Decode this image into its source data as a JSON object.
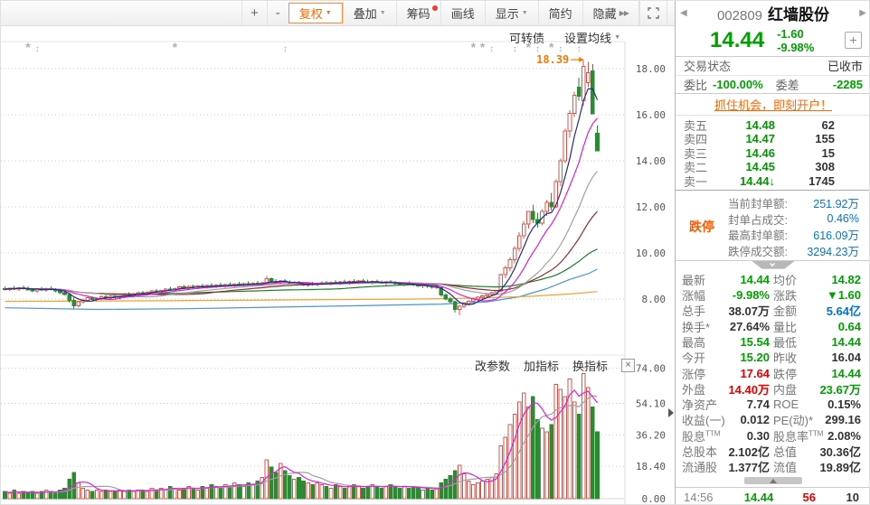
{
  "toolbar": {
    "zoom_in": "+",
    "zoom_out": "-",
    "buttons": [
      {
        "name": "adjust-price",
        "label": "复权",
        "dropdown": true,
        "active": true
      },
      {
        "name": "overlay",
        "label": "叠加",
        "dropdown": true
      },
      {
        "name": "chips",
        "label": "筹码",
        "dot": true
      },
      {
        "name": "draw-line",
        "label": "画线"
      },
      {
        "name": "display",
        "label": "显示",
        "dropdown": true
      },
      {
        "name": "simple-mode",
        "label": "简约"
      },
      {
        "name": "hide",
        "label": "隐藏",
        "chevrons": "▶▶"
      }
    ]
  },
  "chart_links": {
    "convertible_bond": "可转债",
    "ma_settings": "设置均线"
  },
  "indicator_links": {
    "edit_params": "改参数",
    "add_indicator": "加指标",
    "switch_indicator": "换指标",
    "close": "×"
  },
  "chart_data": {
    "type": "candlestick+volume",
    "title": "002809 红墙股份 日K",
    "price_axis": {
      "labels": [
        "18.00",
        "16.00",
        "14.00",
        "12.00",
        "10.00",
        "8.00"
      ],
      "values": [
        18,
        16,
        14,
        12,
        10,
        8
      ]
    },
    "volume_axis": {
      "labels": [
        "74.00",
        "54.10",
        "36.20",
        "18.40",
        "0.00"
      ],
      "values": [
        74,
        54.1,
        36.2,
        18.4,
        0
      ]
    },
    "annotation": {
      "text": "18.39",
      "value": 18.39
    },
    "colors": {
      "up": "#d9544a",
      "down": "#2c8a33",
      "ma5": "#1f2d86",
      "ma10": "#e020d8",
      "ma20": "#a0a0a0",
      "ma30": "#8c3030",
      "ma60": "#1e7d2c",
      "ma_long_blue": "#4a97d2",
      "ma_long_orange": "#f0a32f",
      "vol_ma5": "#e020d8",
      "vol_ma10": "#a0a0a0",
      "annotation": "#ff7700",
      "marker": "#b0b0b0"
    },
    "candles": [
      [
        8.45,
        8.55,
        8.38,
        8.42
      ],
      [
        8.42,
        8.5,
        8.35,
        8.48
      ],
      [
        8.48,
        8.56,
        8.4,
        8.44
      ],
      [
        8.44,
        8.52,
        8.36,
        8.5
      ],
      [
        8.5,
        8.58,
        8.42,
        8.46
      ],
      [
        8.46,
        8.54,
        8.38,
        8.4
      ],
      [
        8.4,
        8.48,
        8.3,
        8.36
      ],
      [
        8.36,
        8.46,
        8.28,
        8.44
      ],
      [
        8.44,
        8.52,
        8.36,
        8.4
      ],
      [
        8.4,
        8.5,
        8.32,
        8.46
      ],
      [
        8.46,
        8.55,
        8.38,
        8.42
      ],
      [
        8.42,
        8.48,
        8.3,
        8.35
      ],
      [
        8.35,
        8.42,
        8.22,
        8.28
      ],
      [
        8.28,
        8.38,
        8.15,
        8.2
      ],
      [
        8.2,
        8.25,
        7.85,
        7.95
      ],
      [
        7.95,
        8.05,
        7.58,
        7.7
      ],
      [
        7.7,
        7.92,
        7.62,
        7.88
      ],
      [
        7.88,
        8.02,
        7.8,
        7.95
      ],
      [
        7.95,
        8.1,
        7.88,
        8.05
      ],
      [
        8.05,
        8.12,
        7.92,
        7.98
      ],
      [
        7.98,
        8.08,
        7.88,
        8.02
      ],
      [
        8.02,
        8.15,
        7.95,
        8.1
      ],
      [
        8.1,
        8.2,
        8.0,
        8.06
      ],
      [
        8.06,
        8.16,
        7.96,
        8.12
      ],
      [
        8.12,
        8.22,
        8.02,
        8.08
      ],
      [
        8.08,
        8.18,
        7.98,
        8.15
      ],
      [
        8.15,
        8.25,
        8.05,
        8.2
      ],
      [
        8.2,
        8.3,
        8.1,
        8.16
      ],
      [
        8.16,
        8.26,
        8.06,
        8.22
      ],
      [
        8.22,
        8.32,
        8.12,
        8.28
      ],
      [
        8.28,
        8.36,
        8.2,
        8.24
      ],
      [
        8.24,
        8.34,
        8.18,
        8.3
      ],
      [
        8.3,
        8.4,
        8.24,
        8.36
      ],
      [
        8.36,
        8.44,
        8.28,
        8.32
      ],
      [
        8.32,
        8.42,
        8.26,
        8.38
      ],
      [
        8.38,
        8.48,
        8.3,
        8.44
      ],
      [
        8.44,
        8.52,
        8.36,
        8.4
      ],
      [
        8.4,
        8.5,
        8.34,
        8.46
      ],
      [
        8.46,
        8.56,
        8.4,
        8.52
      ],
      [
        8.52,
        8.6,
        8.44,
        8.48
      ],
      [
        8.48,
        8.58,
        8.4,
        8.54
      ],
      [
        8.54,
        8.62,
        8.46,
        8.5
      ],
      [
        8.5,
        8.6,
        8.44,
        8.56
      ],
      [
        8.56,
        8.66,
        8.48,
        8.52
      ],
      [
        8.52,
        8.62,
        8.46,
        8.58
      ],
      [
        8.58,
        8.68,
        8.5,
        8.54
      ],
      [
        8.54,
        8.64,
        8.48,
        8.6
      ],
      [
        8.6,
        8.7,
        8.52,
        8.56
      ],
      [
        8.56,
        8.66,
        8.5,
        8.62
      ],
      [
        8.62,
        8.72,
        8.54,
        8.58
      ],
      [
        8.58,
        8.68,
        8.52,
        8.64
      ],
      [
        8.64,
        8.74,
        8.56,
        8.6
      ],
      [
        8.6,
        8.7,
        8.54,
        8.66
      ],
      [
        8.66,
        8.76,
        8.58,
        8.62
      ],
      [
        8.62,
        8.72,
        8.56,
        8.68
      ],
      [
        8.68,
        8.78,
        8.6,
        8.64
      ],
      [
        8.64,
        8.74,
        8.58,
        8.7
      ],
      [
        8.7,
        9.0,
        8.64,
        8.88
      ],
      [
        8.88,
        8.95,
        8.7,
        8.76
      ],
      [
        8.76,
        8.86,
        8.68,
        8.72
      ],
      [
        8.72,
        8.82,
        8.64,
        8.78
      ],
      [
        8.78,
        8.86,
        8.68,
        8.72
      ],
      [
        8.72,
        8.8,
        8.62,
        8.66
      ],
      [
        8.66,
        8.76,
        8.58,
        8.7
      ],
      [
        8.7,
        8.78,
        8.6,
        8.64
      ],
      [
        8.64,
        8.72,
        8.56,
        8.6
      ],
      [
        8.6,
        8.7,
        8.52,
        8.66
      ],
      [
        8.66,
        8.74,
        8.58,
        8.62
      ],
      [
        8.62,
        8.72,
        8.54,
        8.68
      ],
      [
        8.68,
        8.76,
        8.6,
        8.7
      ],
      [
        8.7,
        8.78,
        8.62,
        8.66
      ],
      [
        8.66,
        8.76,
        8.58,
        8.72
      ],
      [
        8.72,
        8.82,
        8.64,
        8.68
      ],
      [
        8.68,
        8.78,
        8.6,
        8.74
      ],
      [
        8.74,
        8.84,
        8.66,
        8.7
      ],
      [
        8.7,
        8.8,
        8.62,
        8.76
      ],
      [
        8.76,
        8.86,
        8.68,
        8.72
      ],
      [
        8.72,
        8.82,
        8.64,
        8.78
      ],
      [
        8.78,
        8.88,
        8.7,
        8.74
      ],
      [
        8.74,
        8.84,
        8.66,
        8.7
      ],
      [
        8.7,
        8.8,
        8.62,
        8.76
      ],
      [
        8.76,
        8.84,
        8.68,
        8.72
      ],
      [
        8.72,
        8.8,
        8.64,
        8.68
      ],
      [
        8.68,
        8.78,
        8.6,
        8.74
      ],
      [
        8.74,
        8.82,
        8.66,
        8.7
      ],
      [
        8.7,
        8.78,
        8.62,
        8.66
      ],
      [
        8.66,
        8.74,
        8.58,
        8.62
      ],
      [
        8.62,
        8.72,
        8.54,
        8.68
      ],
      [
        8.68,
        8.76,
        8.6,
        8.64
      ],
      [
        8.64,
        8.72,
        8.56,
        8.6
      ],
      [
        8.6,
        8.68,
        8.52,
        8.56
      ],
      [
        8.56,
        8.66,
        8.48,
        8.6
      ],
      [
        8.6,
        8.66,
        8.5,
        8.54
      ],
      [
        8.54,
        8.62,
        8.46,
        8.5
      ],
      [
        8.5,
        8.58,
        8.44,
        8.52
      ],
      [
        8.5,
        8.55,
        8.1,
        8.18
      ],
      [
        8.18,
        8.25,
        7.95,
        8.0
      ],
      [
        8.0,
        8.1,
        7.8,
        7.88
      ],
      [
        7.88,
        7.95,
        7.42,
        7.55
      ],
      [
        7.55,
        7.75,
        7.3,
        7.68
      ],
      [
        7.68,
        7.85,
        7.6,
        7.8
      ],
      [
        7.8,
        7.95,
        7.72,
        7.9
      ],
      [
        7.9,
        8.05,
        7.85,
        8.0
      ],
      [
        8.0,
        8.12,
        7.92,
        8.08
      ],
      [
        8.08,
        8.18,
        8.0,
        8.14
      ],
      [
        8.14,
        8.25,
        8.05,
        8.2
      ],
      [
        8.2,
        8.32,
        8.12,
        8.28
      ],
      [
        8.28,
        8.4,
        8.2,
        8.35
      ],
      [
        8.35,
        9.1,
        8.3,
        9.05
      ],
      [
        9.05,
        9.45,
        8.9,
        9.35
      ],
      [
        9.35,
        9.8,
        9.2,
        9.7
      ],
      [
        9.7,
        10.3,
        9.55,
        10.2
      ],
      [
        10.2,
        10.9,
        10.05,
        10.75
      ],
      [
        10.75,
        11.4,
        10.6,
        11.25
      ],
      [
        11.25,
        11.83,
        11.05,
        11.8
      ],
      [
        11.8,
        12.1,
        11.3,
        11.45
      ],
      [
        11.45,
        11.75,
        11.1,
        11.3
      ],
      [
        11.3,
        11.9,
        11.2,
        11.8
      ],
      [
        11.8,
        12.3,
        11.6,
        12.2
      ],
      [
        12.2,
        12.6,
        11.85,
        12.0
      ],
      [
        12.0,
        13.2,
        11.95,
        13.1
      ],
      [
        13.1,
        14.1,
        12.9,
        14.0
      ],
      [
        14.0,
        15.4,
        13.9,
        15.3
      ],
      [
        15.3,
        16.2,
        15.0,
        16.05
      ],
      [
        16.05,
        17.0,
        15.9,
        16.85
      ],
      [
        17.2,
        17.6,
        16.6,
        16.8
      ],
      [
        16.6,
        18.39,
        16.4,
        18.1
      ],
      [
        17.4,
        18.3,
        17.2,
        17.82
      ],
      [
        17.9,
        18.2,
        16.04,
        16.04
      ],
      [
        15.2,
        15.54,
        14.44,
        14.44
      ]
    ],
    "volumes": [
      4,
      3,
      5,
      3,
      4,
      3,
      4,
      3,
      4,
      5,
      4,
      3,
      5,
      6,
      11,
      15,
      9,
      6,
      5,
      4,
      5,
      4,
      5,
      4,
      4,
      5,
      4,
      5,
      4,
      5,
      5,
      4,
      6,
      5,
      6,
      5,
      7,
      6,
      5,
      6,
      7,
      6,
      5,
      7,
      6,
      8,
      7,
      6,
      8,
      7,
      9,
      8,
      7,
      9,
      8,
      10,
      12,
      22,
      18,
      15,
      20,
      16,
      13,
      11,
      12,
      10,
      9,
      8,
      9,
      8,
      7,
      6,
      8,
      7,
      6,
      7,
      8,
      7,
      6,
      7,
      8,
      7,
      6,
      7,
      8,
      7,
      6,
      7,
      6,
      7,
      6,
      5,
      6,
      5,
      6,
      9,
      11,
      13,
      16,
      19,
      14,
      10,
      8,
      9,
      10,
      11,
      12,
      14,
      30,
      35,
      42,
      48,
      55,
      60,
      52,
      58,
      45,
      40,
      38,
      42,
      65,
      62,
      58,
      68,
      55,
      48,
      71,
      63,
      52,
      38
    ],
    "long_ma_blue": [
      [
        0,
        7.62
      ],
      [
        20,
        7.55
      ],
      [
        40,
        7.58
      ],
      [
        60,
        7.65
      ],
      [
        80,
        7.72
      ],
      [
        95,
        7.78
      ],
      [
        105,
        7.88
      ],
      [
        112,
        8.1
      ],
      [
        118,
        8.45
      ],
      [
        123,
        8.85
      ],
      [
        127,
        9.1
      ],
      [
        129,
        9.3
      ]
    ],
    "long_ma_orange": [
      [
        0,
        7.9
      ],
      [
        30,
        7.92
      ],
      [
        60,
        7.96
      ],
      [
        90,
        8.0
      ],
      [
        105,
        8.05
      ],
      [
        115,
        8.12
      ],
      [
        123,
        8.22
      ],
      [
        129,
        8.32
      ]
    ],
    "event_markers": [
      [
        5,
        "star"
      ],
      [
        7,
        "updown"
      ],
      [
        37,
        "star"
      ],
      [
        61,
        "updown"
      ],
      [
        102,
        "star"
      ],
      [
        104,
        "star"
      ],
      [
        106,
        "updown"
      ],
      [
        111,
        "updown"
      ],
      [
        114,
        "star"
      ],
      [
        116,
        "updown"
      ],
      [
        119,
        "star"
      ],
      [
        121,
        "updown"
      ],
      [
        125,
        "updown"
      ]
    ]
  },
  "panel": {
    "prev_arrow": "◀",
    "next_arrow": "▶",
    "code": "002809",
    "name": "红墙股份",
    "price": "14.44",
    "change": "-1.60",
    "change_pct": "-9.98%",
    "add_button": "+",
    "trade_status_label": "交易状态",
    "trade_status": "已收市",
    "weibi_label": "委比",
    "weibi": "-100.00%",
    "weicha_label": "委差",
    "weicha": "-2285",
    "ad_link": "抓住机会，即刻开户！",
    "sell_orders": [
      {
        "label": "卖五",
        "price": "14.48",
        "vol": "62"
      },
      {
        "label": "卖四",
        "price": "14.47",
        "vol": "155"
      },
      {
        "label": "卖三",
        "price": "14.46",
        "vol": "15"
      },
      {
        "label": "卖二",
        "price": "14.45",
        "vol": "308"
      },
      {
        "label": "卖一",
        "price": "14.44↓",
        "vol": "1745"
      }
    ],
    "limit_block": {
      "title": "跌停",
      "rows": [
        {
          "label": "当前封单额:",
          "value": "251.92万"
        },
        {
          "label": "封单占成交:",
          "value": "0.46%"
        },
        {
          "label": "最高封单额:",
          "value": "616.09万"
        },
        {
          "label": "跌停成交额:",
          "value": "3294.23万"
        }
      ]
    },
    "stats": [
      [
        {
          "label": "最新",
          "value": "14.44",
          "c": "g"
        },
        {
          "label": "均价",
          "value": "14.82",
          "c": "g"
        }
      ],
      [
        {
          "label": "涨幅",
          "value": "-9.98%",
          "c": "g"
        },
        {
          "label": "涨跌",
          "value": "▼1.60",
          "c": "g"
        }
      ],
      [
        {
          "label": "总手",
          "value": "38.07万",
          "c": "k"
        },
        {
          "label": "金额",
          "value": "5.64亿",
          "c": "b"
        }
      ],
      [
        {
          "label": "换手*",
          "value": "27.64%",
          "c": "k"
        },
        {
          "label": "量比",
          "value": "0.64",
          "c": "g"
        }
      ],
      [
        {
          "label": "最高",
          "value": "15.54",
          "c": "g"
        },
        {
          "label": "最低",
          "value": "14.44",
          "c": "g"
        }
      ],
      [
        {
          "label": "今开",
          "value": "15.20",
          "c": "g"
        },
        {
          "label": "昨收",
          "value": "16.04",
          "c": "k"
        }
      ],
      [
        {
          "label": "涨停",
          "value": "17.64",
          "c": "r"
        },
        {
          "label": "跌停",
          "value": "14.44",
          "c": "g"
        }
      ],
      [
        {
          "label": "外盘",
          "value": "14.40万",
          "c": "r"
        },
        {
          "label": "内盘",
          "value": "23.67万",
          "c": "g"
        }
      ],
      [
        {
          "label": "净资产",
          "value": "7.74",
          "c": "k"
        },
        {
          "label": "ROE",
          "value": "0.15%",
          "c": "k"
        }
      ],
      [
        {
          "label": "收益(一)",
          "value": "0.012",
          "c": "k"
        },
        {
          "label": "PE(动)*",
          "value": "299.16",
          "c": "k"
        }
      ],
      [
        {
          "label": "股息",
          "sup": "TTM",
          "value": "0.30",
          "c": "k"
        },
        {
          "label": "股息率",
          "sup": "TTM",
          "value": "2.08%",
          "c": "k"
        }
      ],
      [
        {
          "label": "总股本",
          "value": "2.102亿",
          "c": "k"
        },
        {
          "label": "总值",
          "value": "30.36亿",
          "c": "k"
        }
      ],
      [
        {
          "label": "流通股",
          "value": "1.377亿",
          "c": "k"
        },
        {
          "label": "流值",
          "value": "19.89亿",
          "c": "k"
        }
      ]
    ],
    "ticker": {
      "time": "14:56",
      "price": "14.44",
      "vol": "56",
      "count": "10"
    }
  }
}
